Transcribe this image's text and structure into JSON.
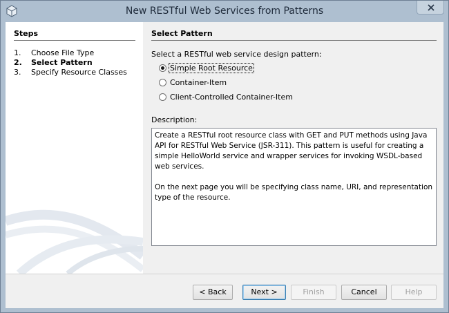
{
  "window": {
    "title": "New RESTful Web Services from Patterns"
  },
  "steps": {
    "title": "Steps",
    "items": [
      {
        "num": "1.",
        "label": "Choose File Type"
      },
      {
        "num": "2.",
        "label": "Select Pattern"
      },
      {
        "num": "3.",
        "label": "Specify Resource Classes"
      }
    ],
    "current_index": 1
  },
  "content": {
    "title": "Select Pattern",
    "prompt": "Select a RESTful web service design pattern:",
    "patterns": [
      {
        "label": "Simple Root Resource",
        "selected": true
      },
      {
        "label": "Container-Item",
        "selected": false
      },
      {
        "label": "Client-Controlled Container-Item",
        "selected": false
      }
    ],
    "description_label": "Description:",
    "description": {
      "para1": "Create a RESTful root resource class with GET and PUT methods using Java API for RESTful Web Service (JSR-311). This pattern is useful for creating a simple HelloWorld service and wrapper services for invoking WSDL-based web services.",
      "para2": "On the next page you will be specifying class name, URI, and representation type of the resource."
    }
  },
  "buttons": {
    "back": "< Back",
    "next": "Next >",
    "finish": "Finish",
    "cancel": "Cancel",
    "help": "Help"
  },
  "colors": {
    "frame": "#aebfd0",
    "client": "#f0f0f0",
    "default_button_border": "#3c7fb1"
  },
  "icons": {
    "app": "netbeans-cube-icon",
    "close": "close-icon"
  }
}
